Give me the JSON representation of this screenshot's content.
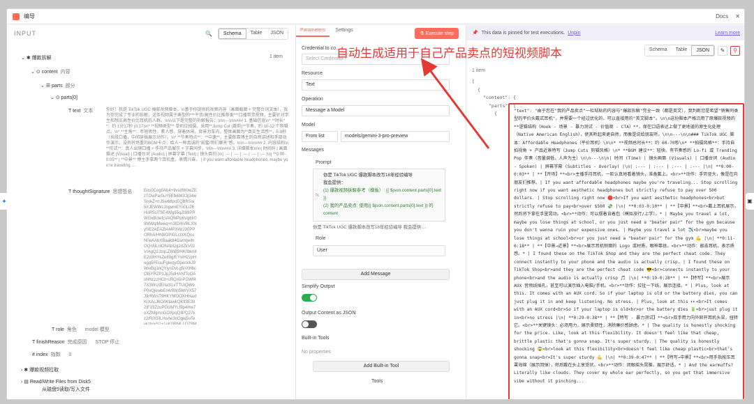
{
  "window": {
    "title": "编导",
    "docs": "Docs"
  },
  "input_panel": {
    "title": "INPUT",
    "view_tabs": [
      "Schema",
      "Table",
      "JSON"
    ],
    "active_tab": "Schema",
    "items": [
      {
        "key": "爆款拆解",
        "badge": "1 item"
      },
      {
        "key": "content",
        "sub": "内容"
      },
      {
        "key": "parts",
        "sub": "部分"
      },
      {
        "key": "parts[0]"
      },
      {
        "key": "text",
        "sub": "文本",
        "value": "你好！我是 TikTok UGC 爆款视频脚本，\\n基于你提供的视频内容（画面截图 + 完整台词文本），我为你完成了专业的拆解，这条视频属于典型的***干货/高性价比推荐类***口播带货视频，主要针对学生和想买高性价比耳机的人群。\\n\\n以下是完整的拆解报告：\\n\\n---\\n\\n### 1. 基础信息\\n* **时长**：约 1分17秒 (0:17)\\n* **视频类型** 单机位拍摄，采用**Jump Cut (跳剪)**节奏，约 10-12 个剪辑点。\\n* **主角**：年轻男性，素人感，穿着休闲。背景为车内，整体画面为**真实生活感**，5-8秒（长段口播，中间穿插展示动作）。\\n* **节奏特点**：**中速**，主要依靠博主的自然讲述和手部动作演示，没有转场重的BGM卡点，给人一种真诚的\"闺蜜/哥们聊天\"感。\\n\\n---\\n\\n### 2. 内容结构\\n**形式**：真人出镜口播 + 手持产品展示 + 字幕同步。\\n\\n---\\n\\n### 3. 详细脚本\\n\\n| 时间码 | 画面描述 (Visual) | 口播台词 (Audio) | 屏幕字幕 (Text) | 镜头目的 |\\n| :--- | :--- | :--- | :--- | :--- |\\n| **0:00-0:05** | **中景** 博主手拿两个耳机盒，表情兴奋。 | If you want affordable headphones, maybe you're traveling, ..."
      },
      {
        "key": "thoughtSignature",
        "sub": "思想签名",
        "value": "Eos0Cog0Ab4+9vsdW0wZEzTOwPa/0uY5Efk6MX3j34wSrvkZ+rrJ5w68pcEQBRSsi5/rJEWWzJogvmEYn0Li26HoR5sIT5E4Wg55qZt89PRWGxBolefcVAQMPp6Vg6Ir08MWqlMewq+n3ID/6VBLXNySE2AEAZlAMPXW/J30PPORhA/Hh9IOPlGLctXKQcuN0aAAbXBaak84Gamtje/lnOQnNLnlONAbIzg2rtZkV0zV/AgQ2JzqLZ6hB9HK/lbkn8E2d3HYkZe89g/EYxIH2zpHugg5FEuuFglwqyOpe/o/kJ9WwBg1nQYiysDvLg5nXHbcOt5YRZP1JpJ5dHANfToOAsNNczzHOt+cRQXlnPGWf47X3WUsE/Ia3/LvTTUIQWbP0xQjewbEn4/8W/5MrVX57J9rRWsT9HKYMOOXHHaxtKrXAcJ6O/IKtawkQKtf3E3x2IF19ZzuPGUMYLf9p4Hw7oXZMgmnGOXpqQllPQ27kz2/R/X5ILHoAe3nOgw5uTeykzhrxS1+1sKl3BMLLOZ8Mhadq+OSGVwJFbOVQRhOMOVCnCmPQZEb69dB4dufhR0JEB4fDzgtmXvWu3l..."
      },
      {
        "key": "role",
        "sub": "角色",
        "value": "model 模型"
      },
      {
        "key": "finishReason",
        "sub": "完成原因",
        "value": "STOP 停止"
      },
      {
        "key": "index",
        "sub": "指数",
        "value": "0"
      },
      {
        "key": "爆款视频拉取"
      },
      {
        "key": "Read/Write Files from Disk5",
        "sub2": "从磁盘5读取/写入文件"
      },
      {
        "key": "人物生成"
      }
    ]
  },
  "params_panel": {
    "tabs": [
      "Parameters",
      "Settings"
    ],
    "active_tab": "Parameters",
    "execute_label": "Execute step",
    "credential_label": "Credential to co...",
    "credential_placeholder": "Select Credential",
    "resource_label": "Resource",
    "resource_value": "Text",
    "operation_label": "Operation",
    "operation_value": "Message a Model",
    "model_label": "Model",
    "model_mode": "From list",
    "model_value": "models/gemini-3-pro-preview",
    "messages_label": "Messages",
    "prompt_label": "Prompt",
    "prompt_lines": [
      "你是 TikTok UGC 爆款脚本改写18年经验编导",
      "我会提供：",
      "(1) 爆款视频拆解参考（模板）: {{ $json.content.parts[0].text }}",
      "(2) 我的产品卖点: 使用{{ $json.content.parts[0].text }} 的content",
      "你是 TikTok UGC 爆款脚本改写18年经验编导 我会提供:..."
    ],
    "role_label": "Role",
    "role_value": "User",
    "add_message": "Add Message",
    "simplify_label": "Simplify Output",
    "as_json_label": "Output Content as JSON",
    "builtin_label": "Built-in Tools",
    "builtin_empty": "No properties",
    "add_builtin": "Add Built-in Tool",
    "tools_label": "Tools"
  },
  "output_panel": {
    "pin_notice": "This data is pinned for test executions.",
    "unpin": "Unpin",
    "learn_more": "Learn more",
    "view_tabs": [
      "Schema",
      "Table",
      "JSON"
    ],
    "active_tab": "JSON",
    "count": "1 item",
    "json_lines": [
      "[",
      "{",
      "\"content\": {",
      "\"parts\": [",
      "{"
    ],
    "text_key": "\"text\":",
    "text_value": "\"由于您在\"我的产品卖点\"一栏粘贴的内容与\"爆款拆解\"完全一致（都是英文），我判断您是希望\"销售同类型的平价头戴式耳机\"，并需要一个经过优化的、可以直接用的\"英文脚本\"。\\n\\n这份脚本严格沿用了原爆款视频的**逻辑结构（Hook - 场景 - 暴力测试 - 价值观 - CTA）**，保在口语表达上做了更地道的原生化处理（Native American English），使其听起来更自然，而像是说给朋友听。\\n\\n---\\n\\n### TikTok UGC 脚本：Affordable Headphones（平价耳机）\\n\\n* **视频总时长**：约 60-70秒\\n* **拍摄风格**：手持自拍视角 + 产品近景特写（Jump Cuts 剪辑风格）\\n* **BGM 建议**：轻快、有节奏感的 Lo-fi 或 Trending Pop 伴奏（音量调低，人声为主）\\n\\n---\\n\\n| 时间 (Time) | 镜头画面 (Visuals) | 口播台词 (Audio - Spoken) | 屏幕字幕 (Subtitles - Overlay) |\\n| :--- | :--- | :--- | :--- |\\n| **0:00-0:03** | **【开场】**<br>主播手持耳机，一脸认真地看着镜头，准备戴上。<br>**动作：手势竖大，像是在向朋友们推荐。| If you want affordable headphones maybe you're traveling... Stop scrolling right now if you want aesthetic headphones but strictly refuse to pay over 500 dollars. | Stop scrolling right now 🛑<br>If you want aesthetic headphones<br>but strictly refuse to pay<br>over $500 💸 |\\n| **0:03-0:10** | **【中景】**<br>戴上耳机展示，然后将下拿在手里晃动。<br>**动作：可以摆着背着包（模拟旅行/上学）。* | Maybe you travel a lot, maybe you lose things at school, or you just need a \"beater pair\" for the gym because you don't wanna ruin your expensive ones. | Maybe you travel a lot ✈️<br>maybe you lose things at school<br>or you just need a \"beater pair\" for the gym 💪 |\\n| **0:11-0:18** | **【中景→近景】**<br>展示耳机侧面的 Logo 或材质，眼神靠拢。<br>**动作：敲击耳机，表示质感。* | I found these on the TikTok Shop and they are the perfect cheat code. They connect instantly to your phone and the audio is actually crisp. | I found these on TikTok Shop<br>and they are the perfect cheat code 😎<br>connects instantly to your phone<br>and the audio is actually crisp 🎵 |\\n| **0:19-0:28** | **【特写】**<br>展示 AUX 音频线插孔，甚至可以演示插入电脑/手机。<br>**动作：拉扯一下线，展示连接。* | Plus, look at this. It comes with an AUX cord. So if your laptop is old or the battery dies, you can just plug it in and keep listening. No stress. | Plus, look at this 👀<br>It comes with an AUX cord<br>So if your laptop is old<br>or the battery dies 🔋<br>just plug it in<br>no stress |\\n| **0:29-0:38** | **【特写 - 暴力测试】**<br>双手用力向外掰开耳机头梁，扭转它。<br>**关键镜头：必须用力，展示柔韧性，消除廉价感顾虑。* | The quality is honestly shocking for the price. Like, look at this flexibility. It doesn't feel like that cheap, brittle plastic that's gonna snap. It's super sturdy. | The quality is honestly shocking 😱<br>look at this flexibility<br>doesn't feel like cheap plastic<br>that's gonna snap<br>It's super sturdy 💪 |\\n| **0:39-0:47** | **【特写→中景】**<br>用手指按压耳罩海绵（展示回弹），然后戴在头上享受状。<br>**动作：闭眼摇头晃脑，展示舒适。* | And the earmuffs? Literally like clouds. They cover my whole ear perfectly, so you get that immersive vibe without it pinching..."
  },
  "annotation": {
    "text": "自动生成适用于自己产品卖点的短视频脚本"
  },
  "colors": {
    "accent": "#ff6d5a",
    "annotation_red": "#e53935",
    "switch_on": "#2eaa4f",
    "pin_bg": "#efeef9"
  }
}
